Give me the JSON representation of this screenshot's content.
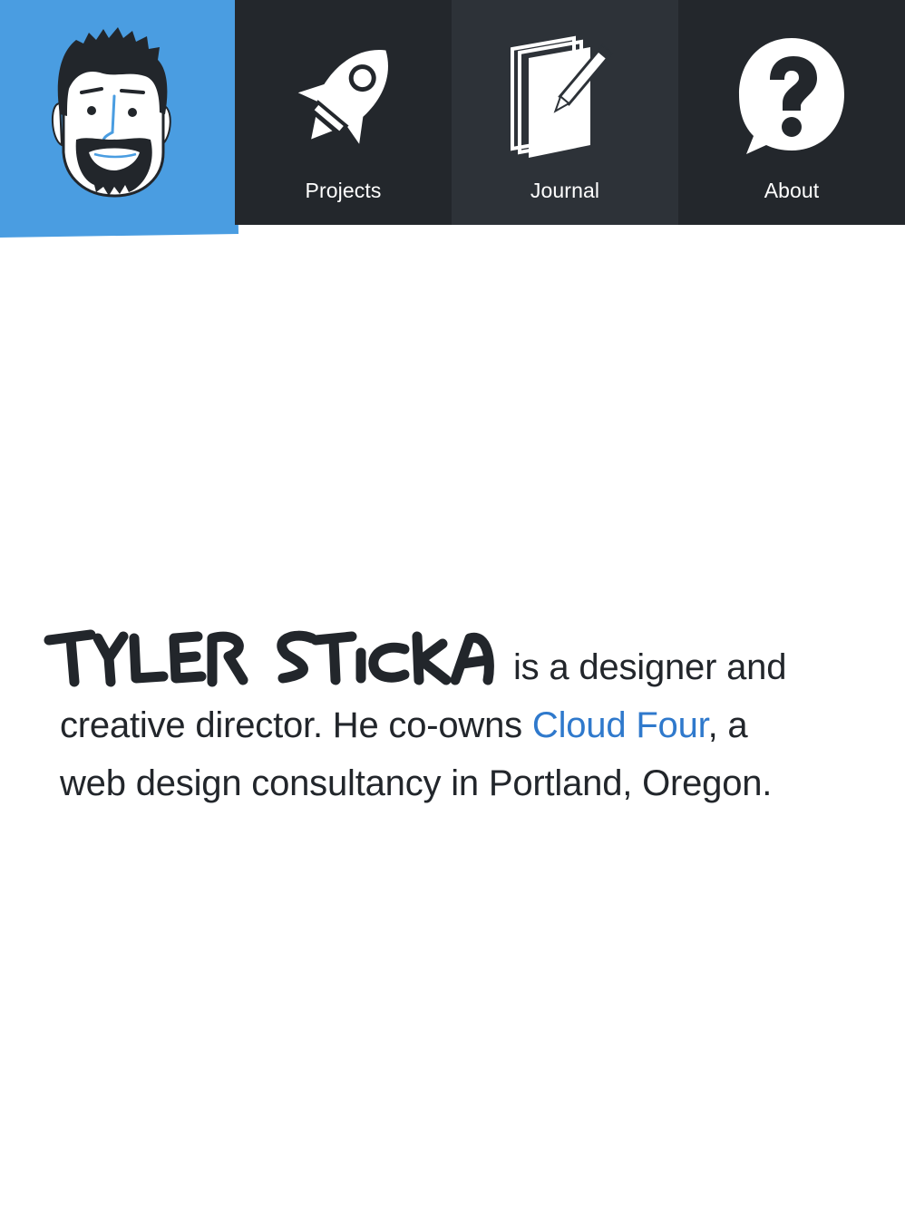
{
  "nav": {
    "home": {
      "avatar_icon": "face-caricature-icon"
    },
    "items": [
      {
        "label": "Projects",
        "icon": "rocket-icon"
      },
      {
        "label": "Journal",
        "icon": "notebook-pencil-icon"
      },
      {
        "label": "About",
        "icon": "question-bubble-icon"
      }
    ]
  },
  "intro": {
    "name": "TYLER STICKA",
    "line1": "is a designer and",
    "line2_before": "creative director. He co-owns ",
    "company_link": "Cloud Four",
    "line2_after": ", a",
    "line3": "web design consultancy in Portland, Oregon."
  },
  "colors": {
    "accent_blue": "#4a9de1",
    "nav_dark": "#23272c",
    "nav_active": "#2d3238",
    "link": "#2f79cc",
    "text": "#22262b"
  }
}
